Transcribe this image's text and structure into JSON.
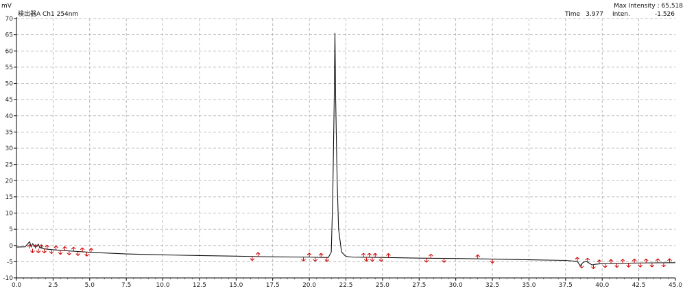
{
  "header": {
    "unit_label": "mV",
    "channel_label": "検出器A Ch1 254nm",
    "max_intensity_label": "Max Intensity : 65,518",
    "time_label": "Time",
    "time_value": "3.977",
    "inten_label": "Inten.",
    "inten_value": "-1.526"
  },
  "colors": {
    "trace": "#111111",
    "marker": "#cc0000",
    "grid": "#aaaaaa",
    "axis": "#000000"
  },
  "chart_data": {
    "type": "line",
    "title": "",
    "xlabel": "",
    "ylabel": "mV",
    "xlim": [
      0.0,
      45.0
    ],
    "ylim": [
      -10,
      70
    ],
    "x_ticks": [
      0.0,
      2.5,
      5.0,
      7.5,
      10.0,
      12.5,
      15.0,
      17.5,
      20.0,
      22.5,
      25.0,
      27.5,
      30.0,
      32.5,
      35.0,
      37.5,
      40.0,
      42.5,
      45.0
    ],
    "x_tick_labels": [
      "0.0",
      "2.5",
      "5.0",
      "7.5",
      "10.0",
      "12.5",
      "15.0",
      "17.5",
      "20.0",
      "22.5",
      "25.0",
      "27.5",
      "30.0",
      "32.5",
      "35.0",
      "37.5",
      "40.0",
      "42.5",
      "45.0"
    ],
    "y_ticks": [
      -10,
      -5,
      0,
      5,
      10,
      15,
      20,
      25,
      30,
      35,
      40,
      45,
      50,
      55,
      60,
      65,
      70
    ],
    "y_tick_labels": [
      "-10",
      "-5",
      "0",
      "5",
      "10",
      "15",
      "20",
      "25",
      "30",
      "35",
      "40",
      "45",
      "50",
      "55",
      "60",
      "65",
      "70"
    ],
    "grid": true,
    "series": [
      {
        "x": [
          0.0,
          0.6,
          0.9,
          1.0,
          1.1,
          1.3,
          1.5,
          1.6,
          1.7,
          1.8,
          2.0,
          2.5,
          3.0,
          4.0,
          5.0,
          7.5,
          10.0,
          12.5,
          15.0,
          17.5,
          20.0,
          21.0,
          21.3,
          21.5,
          21.6,
          21.7,
          21.75,
          21.8,
          21.9,
          22.0,
          22.2,
          22.5,
          23.0,
          25.0,
          27.5,
          30.0,
          32.5,
          35.0,
          37.5,
          38.3,
          38.5,
          38.7,
          38.9,
          39.1,
          39.3,
          39.5,
          40.0,
          42.5,
          45.0
        ],
        "y": [
          -0.5,
          -0.4,
          1.2,
          -0.5,
          0.6,
          -0.6,
          0.4,
          -0.8,
          -0.4,
          -1.0,
          -1.1,
          -1.3,
          -1.5,
          -1.8,
          -2.1,
          -2.6,
          -2.9,
          -3.1,
          -3.3,
          -3.5,
          -3.6,
          -3.7,
          -3.7,
          -2.0,
          15.0,
          45.0,
          65.5,
          45.0,
          20.0,
          5.0,
          -2.0,
          -3.4,
          -3.6,
          -3.7,
          -3.9,
          -4.0,
          -4.2,
          -4.4,
          -4.6,
          -4.9,
          -6.2,
          -5.2,
          -4.9,
          -5.4,
          -6.0,
          -5.8,
          -5.6,
          -5.4,
          -5.3
        ]
      }
    ],
    "markers": {
      "x": [
        0.9,
        1.1,
        1.3,
        1.5,
        1.7,
        1.9,
        2.1,
        2.4,
        2.7,
        3.0,
        3.3,
        3.6,
        3.9,
        4.2,
        4.5,
        4.8,
        5.1,
        16.1,
        16.5,
        19.6,
        20.0,
        20.4,
        20.8,
        21.2,
        23.7,
        23.9,
        24.1,
        24.3,
        24.5,
        24.9,
        25.4,
        28.0,
        28.3,
        29.2,
        31.5,
        32.5,
        38.3,
        38.6,
        39.0,
        39.4,
        39.8,
        40.2,
        40.6,
        41.0,
        41.4,
        41.8,
        42.2,
        42.6,
        43.0,
        43.4,
        43.8,
        44.2,
        44.6
      ]
    }
  }
}
